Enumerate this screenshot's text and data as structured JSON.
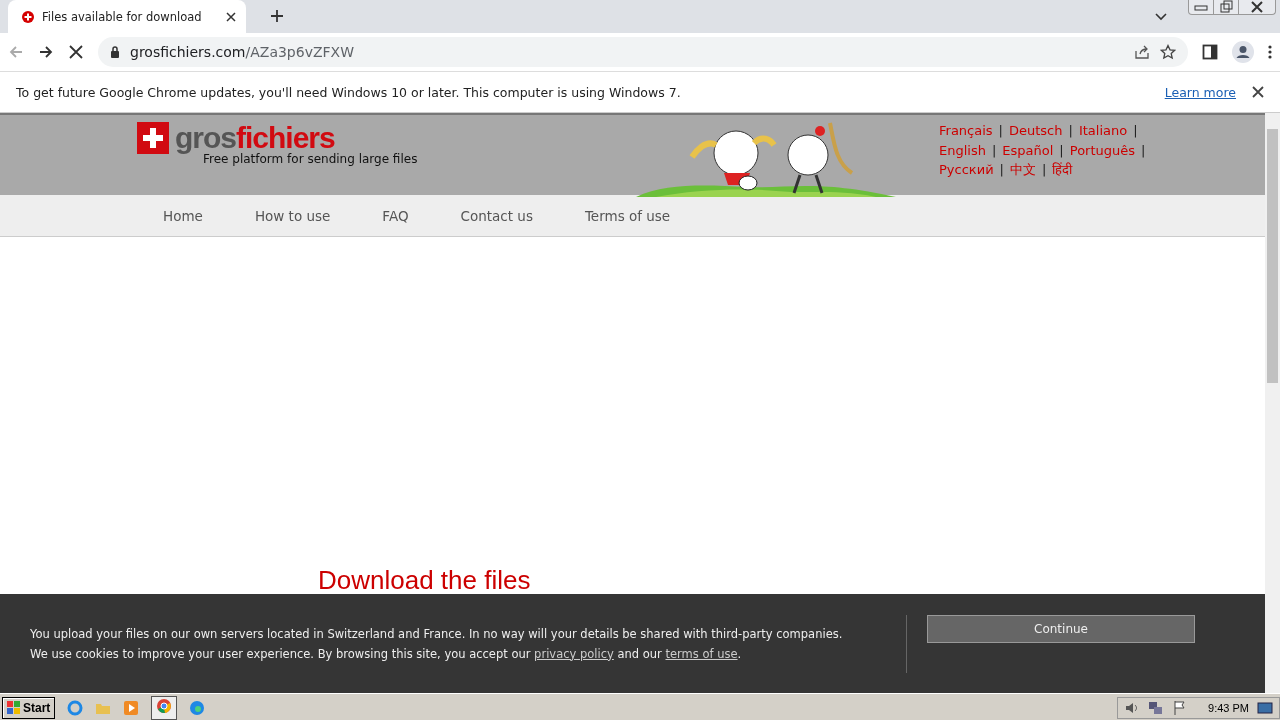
{
  "browser": {
    "tab": {
      "title": "Files available for download"
    },
    "address": {
      "host": "grosfichiers.com",
      "path": "/AZa3p6vZFXW"
    },
    "loading": true
  },
  "infobar": {
    "message": "To get future Google Chrome updates, you'll need Windows 10 or later. This computer is using Windows 7.",
    "link": "Learn more"
  },
  "site": {
    "logo": {
      "part_1": "gros",
      "part_2": "fichiers"
    },
    "tagline": "Free platform for sending large files",
    "languages": [
      [
        {
          "label": "Français",
          "separator": "|"
        },
        {
          "label": "Deutsch",
          "separator": "|"
        },
        {
          "label": "Italiano",
          "separator": "|"
        }
      ],
      [
        {
          "label": "English",
          "separator": "|"
        },
        {
          "label": "Español",
          "separator": "|"
        },
        {
          "label": "Português",
          "separator": "|"
        }
      ],
      [
        {
          "label": "Русский",
          "separator": "|"
        },
        {
          "label": "中文",
          "separator": "|"
        },
        {
          "label": "हिंदी"
        }
      ]
    ],
    "nav": [
      "Home",
      "How to use",
      "FAQ",
      "Contact us",
      "Terms of use"
    ],
    "heading": "Download the files"
  },
  "cookie_banner": {
    "line_1": "You upload your files on our own servers located in Switzerland and France. In no way will your details be shared with third-party companies.",
    "line_2_start": "We use cookies to improve your user experience. By browsing this site, you accept our ",
    "link_1": "privacy policy",
    "line_2_middle": " and our ",
    "link_2": "terms of use",
    "line_2_end": ".",
    "button": "Continue"
  },
  "taskbar": {
    "start": "Start",
    "clock": "9:43 PM"
  }
}
